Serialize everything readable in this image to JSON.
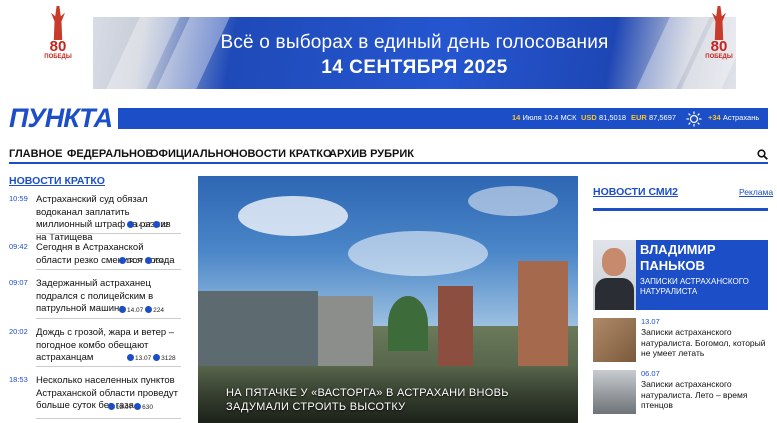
{
  "banner": {
    "line1": "Всё о выборах в единый день голосования",
    "line2": "14 СЕНТЯБРЯ 2025",
    "badge_num": "80",
    "badge_sub": "ПОБЕДЫ"
  },
  "header": {
    "logo": "ПУНКТА",
    "date_day": "14",
    "date_rest": "Июля 10:4 МСК",
    "usd_label": "USD",
    "usd_value": "81,5018",
    "eur_label": "EUR",
    "eur_value": "87,5697",
    "temp": "+34",
    "city": "Астрахань"
  },
  "nav": {
    "items": [
      "ГЛАВНОЕ",
      "ФЕДЕРАЛЬНОЕ",
      "ОФИЦИАЛЬНО",
      "НОВОСТИ КРАТКО",
      "АРХИВ РУБРИК"
    ]
  },
  "news_brief": {
    "title": "НОВОСТИ КРАТКО",
    "items": [
      {
        "time": "10:59",
        "headline": "Астраханский суд обязал водоканал заплатить миллионный штраф за разлив на Татищева",
        "date": "14.07",
        "views": "22"
      },
      {
        "time": "09:42",
        "headline": "Сегодня в Астраханской области резко сменится погода",
        "date": "14.07",
        "views": "734"
      },
      {
        "time": "09:07",
        "headline": "Задержанный астраханец подрался с полицейским в патрульной машине",
        "date": "14.07",
        "views": "224"
      },
      {
        "time": "20:02",
        "headline": "Дождь с грозой, жара и ветер – погодное комбо обещают астраханцам",
        "date": "13.07",
        "views": "3128"
      },
      {
        "time": "18:53",
        "headline": "Несколько населенных пунктов Астраханской области проведут больше суток без газа",
        "date": "13.07",
        "views": "630"
      }
    ]
  },
  "hero": {
    "caption": "НА ПЯТАЧКЕ У «ВАСТОРГА» В АСТРАХАНИ ВНОВЬ ЗАДУМАЛИ СТРОИТЬ ВЫСОТКУ"
  },
  "smi": {
    "title": "НОВОСТИ СМИ2",
    "ads": "Реклама"
  },
  "author": {
    "name": "ВЛАДИМИР ПАНЬКОВ",
    "column": "ЗАПИСКИ АСТРАХАНСКОГО НАТУРАЛИСТА"
  },
  "side_news": [
    {
      "date": "13.07",
      "headline": "Записки астраханского натуралиста. Богомол, который не умеет летать"
    },
    {
      "date": "06.07",
      "headline": "Записки астраханского натуралиста. Лето – время птенцов"
    }
  ],
  "colors": {
    "brand": "#1c4fc7",
    "accent": "#f4c430",
    "badge": "#c8231c"
  }
}
